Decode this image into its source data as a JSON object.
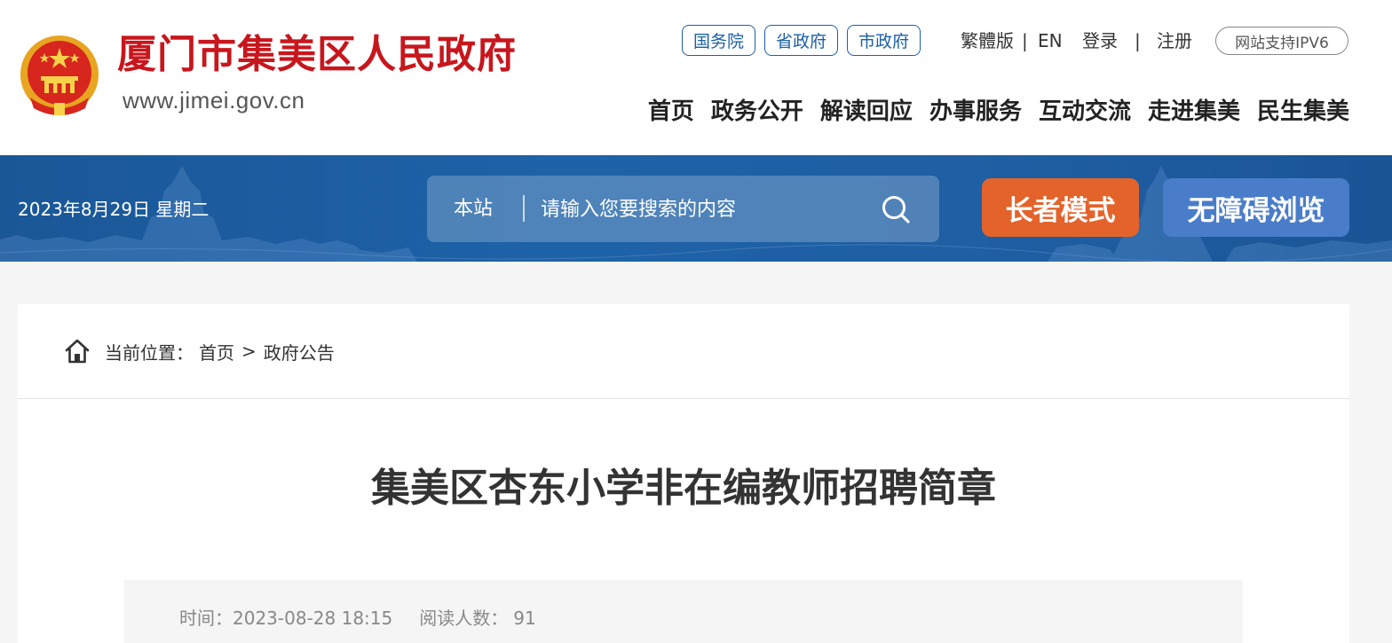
{
  "header": {
    "site_title": "厦门市集美区人民政府",
    "site_url": "www.jimei.gov.cn",
    "gov_links": [
      "国务院",
      "省政府",
      "市政府"
    ],
    "traditional": "繁體版",
    "lang_sep": "|",
    "english": "EN",
    "login": "登录",
    "auth_sep": "|",
    "register": "注册",
    "ipv6": "网站支持IPV6",
    "nav": [
      "首页",
      "政务公开",
      "解读回应",
      "办事服务",
      "互动交流",
      "走进集美",
      "民生集美"
    ]
  },
  "banner": {
    "date": "2023年8月29日 星期二",
    "search_scope": "本站",
    "search_placeholder": "请输入您要搜索的内容",
    "elder_mode": "长者模式",
    "accessible": "无障碍浏览"
  },
  "breadcrumb": {
    "label": "当前位置：",
    "home": "首页",
    "sep": ">",
    "current": "政府公告"
  },
  "article": {
    "title": "集美区杏东小学非在编教师招聘简章",
    "time_label": "时间：",
    "time": "2023-08-28 18:15",
    "reads_label": "阅读人数：",
    "reads": "91"
  },
  "colors": {
    "brand_red": "#c8161d",
    "link_blue": "#1b5fa8",
    "banner_blue": "#1e62a8",
    "elder_orange": "#e4632a",
    "access_blue": "#4a7dc9"
  }
}
